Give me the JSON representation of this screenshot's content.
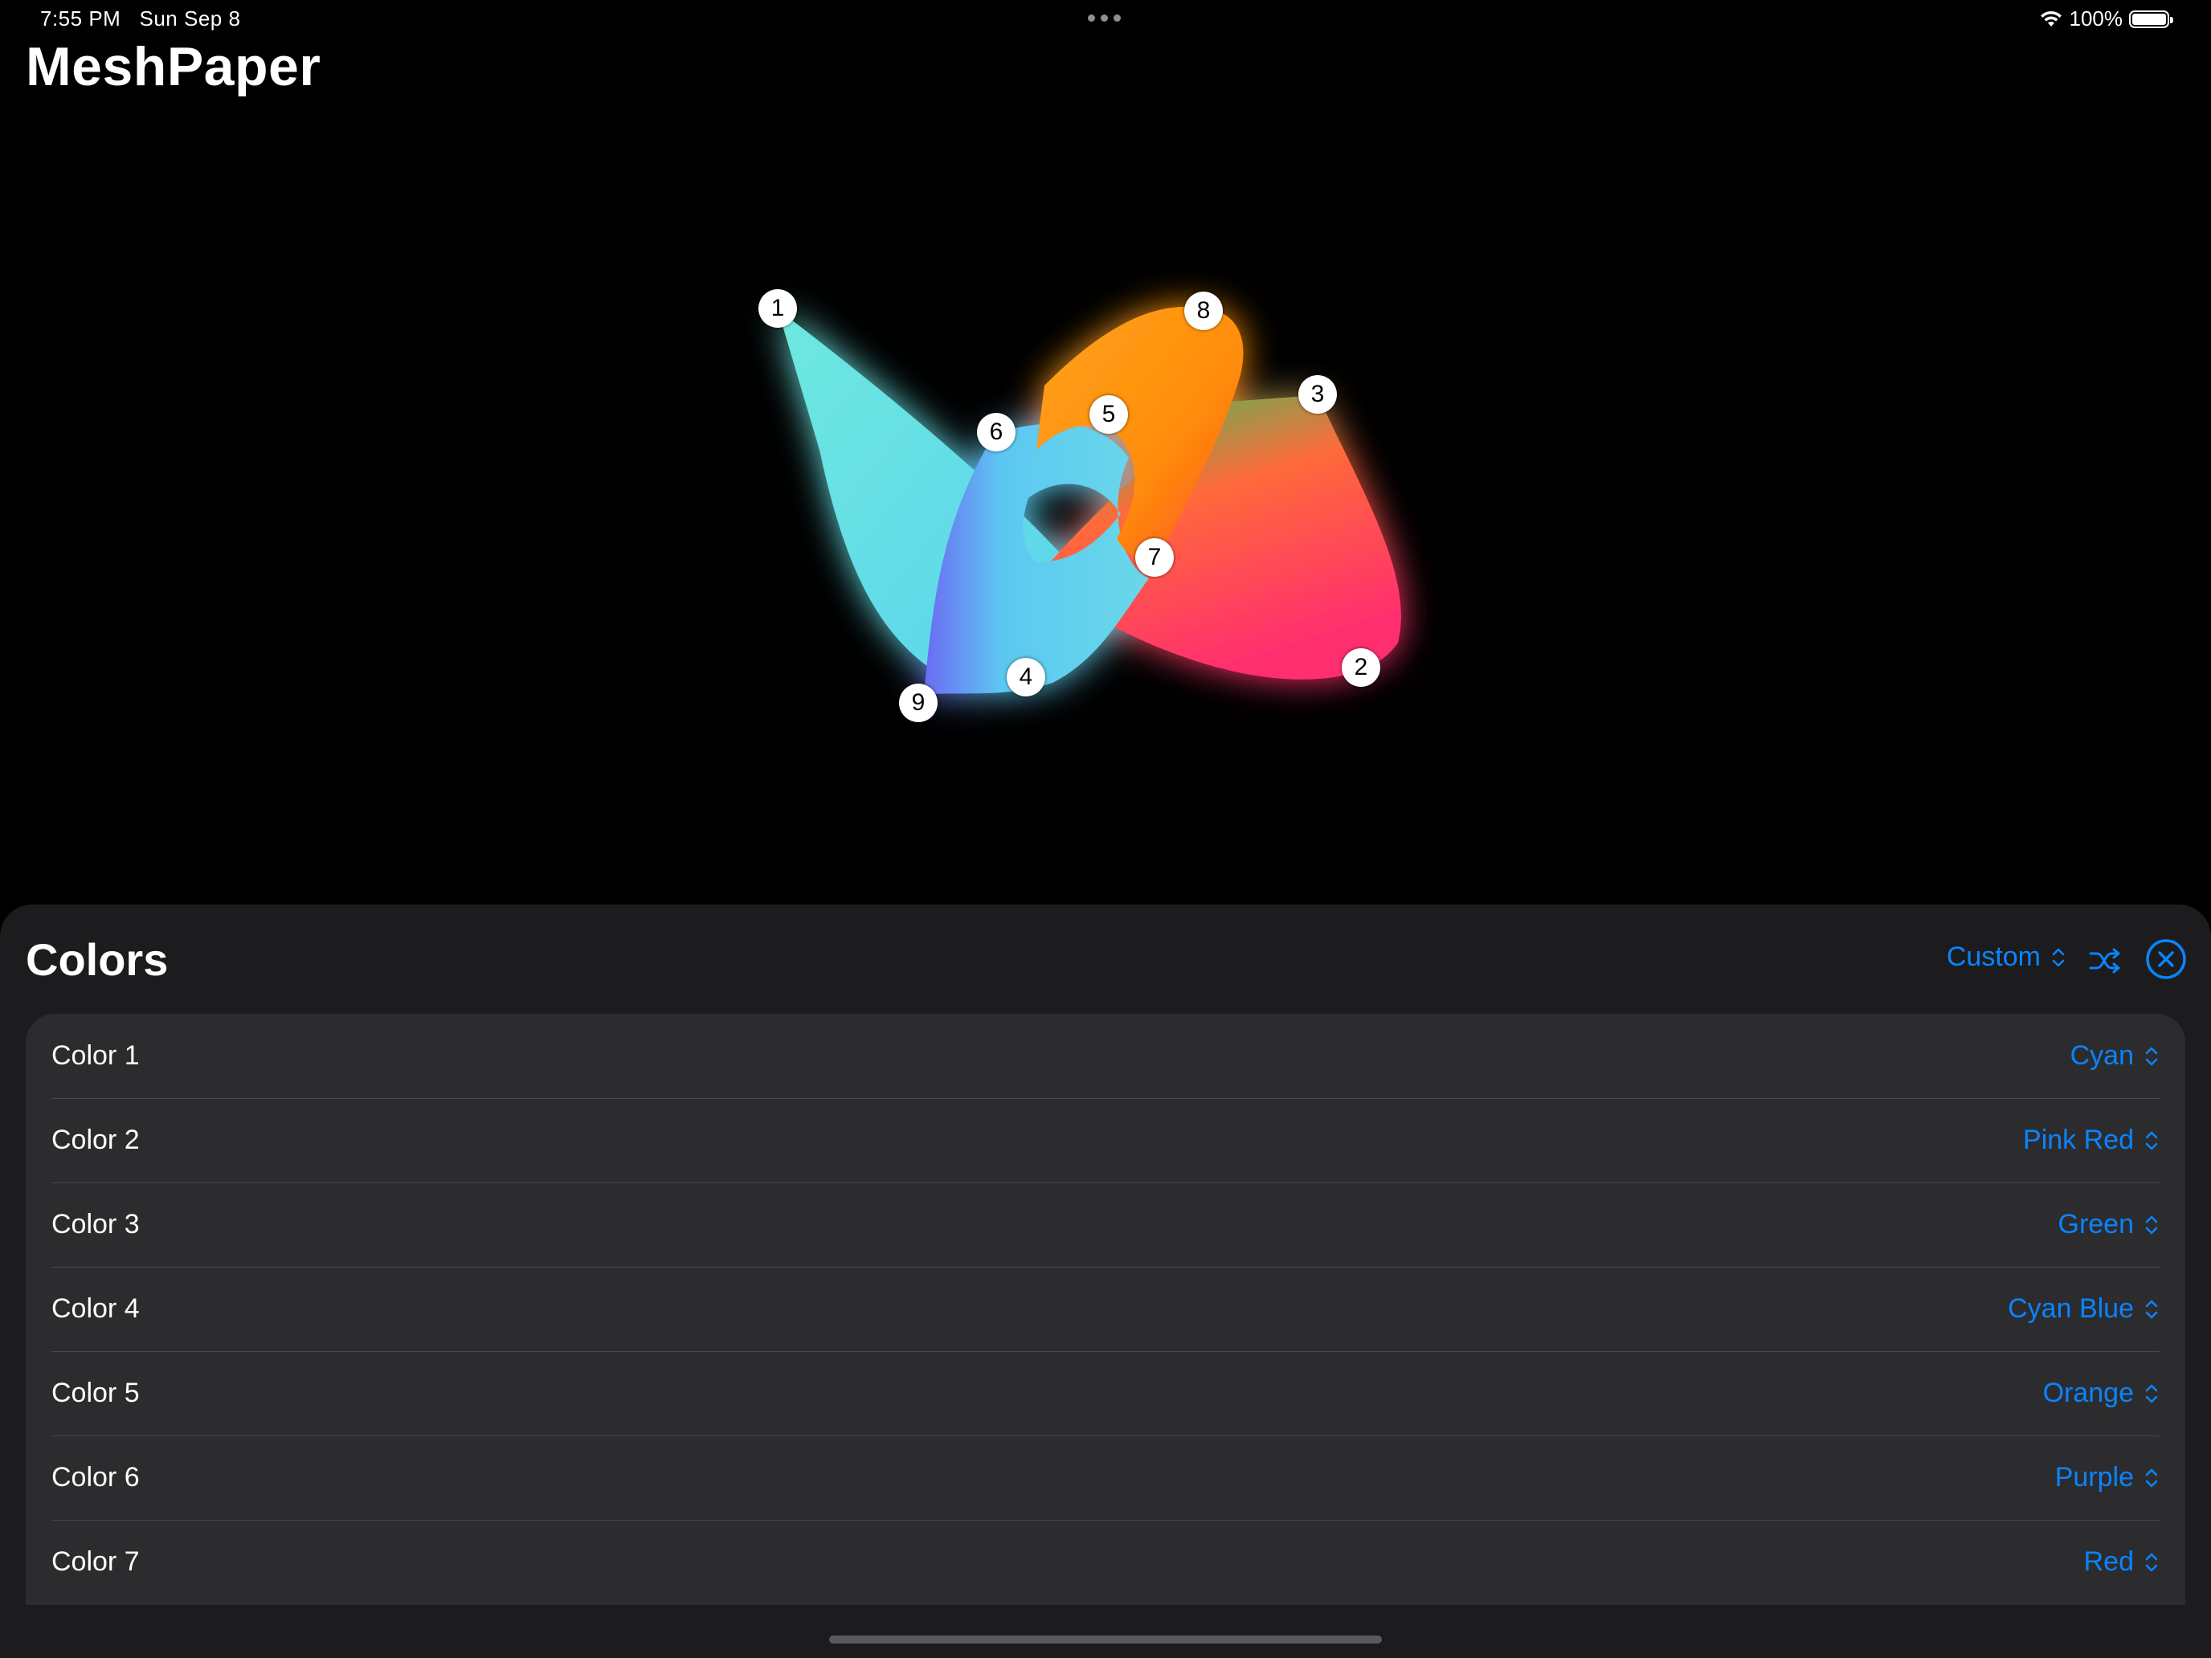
{
  "status_bar": {
    "time": "7:55 PM",
    "date": "Sun Sep 8",
    "battery": "100%"
  },
  "app": {
    "title": "MeshPaper"
  },
  "mesh": {
    "control_points": [
      "1",
      "2",
      "3",
      "4",
      "5",
      "6",
      "7",
      "8",
      "9"
    ]
  },
  "colors_panel": {
    "title": "Colors",
    "preset": "Custom",
    "rows": [
      {
        "label": "Color 1",
        "value": "Cyan"
      },
      {
        "label": "Color 2",
        "value": "Pink Red"
      },
      {
        "label": "Color 3",
        "value": "Green"
      },
      {
        "label": "Color 4",
        "value": "Cyan Blue"
      },
      {
        "label": "Color 5",
        "value": "Orange"
      },
      {
        "label": "Color 6",
        "value": "Purple"
      },
      {
        "label": "Color 7",
        "value": "Red"
      }
    ]
  },
  "palette": {
    "accent": "#0a84ff",
    "cyan": "#5ee0e0",
    "pink_red": "#ff3b6b",
    "green": "#34c759",
    "orange": "#ff9f0a",
    "purple": "#5e5ce6",
    "red": "#ff453a"
  }
}
